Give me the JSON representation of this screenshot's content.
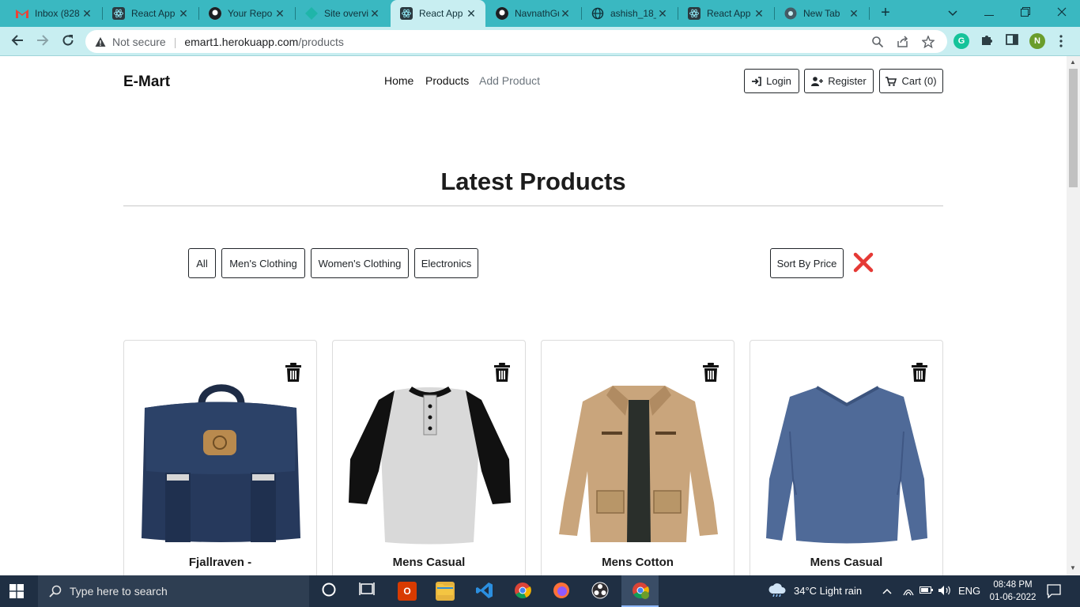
{
  "browser": {
    "tabs": [
      {
        "title": "Inbox (828",
        "icon": "gmail-icon",
        "active": false
      },
      {
        "title": "React App",
        "icon": "react-icon",
        "active": false
      },
      {
        "title": "Your Repo",
        "icon": "github-icon",
        "active": false
      },
      {
        "title": "Site overvi",
        "icon": "netlify-icon",
        "active": false
      },
      {
        "title": "React App",
        "icon": "react-icon",
        "active": true
      },
      {
        "title": "NavnathGu",
        "icon": "github-icon",
        "active": false
      },
      {
        "title": "ashish_18_",
        "icon": "globe-icon",
        "active": false
      },
      {
        "title": "React App",
        "icon": "react-icon",
        "active": false
      },
      {
        "title": "New Tab",
        "icon": "chrome-icon",
        "active": false
      }
    ],
    "security_label": "Not secure",
    "url_host": "emart1.herokuapp.com",
    "url_path": "/products",
    "profile_initial": "N"
  },
  "site": {
    "brand": "E-Mart",
    "nav": {
      "home": "Home",
      "products": "Products",
      "add_product": "Add Product"
    },
    "actions": {
      "login": "Login",
      "register": "Register",
      "cart": "Cart (0)"
    }
  },
  "main": {
    "heading": "Latest Products",
    "filters": [
      "All",
      "Men's Clothing",
      "Women's Clothing",
      "Electronics"
    ],
    "sort_label": "Sort By Price",
    "products": [
      {
        "title": "Fjallraven -"
      },
      {
        "title": "Mens Casual"
      },
      {
        "title": "Mens Cotton"
      },
      {
        "title": "Mens Casual"
      }
    ]
  },
  "taskbar": {
    "search_placeholder": "Type here to search",
    "weather": "34°C  Light rain",
    "language": "ENG",
    "time": "08:48 PM",
    "date": "01-06-2022"
  },
  "colors": {
    "tab_bar": "#3ab8c1",
    "address_bar": "#c8eef1",
    "clear_filter": "#e53935",
    "taskbar": "#1f2f43"
  }
}
